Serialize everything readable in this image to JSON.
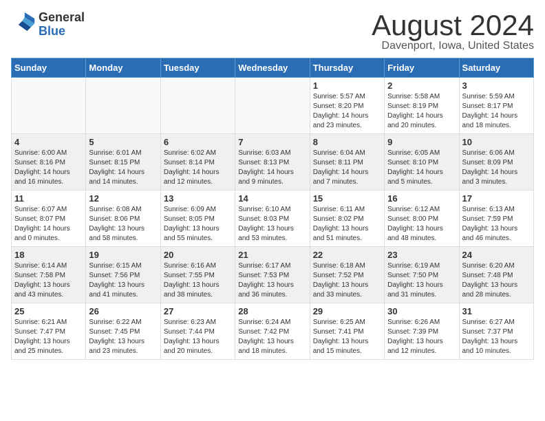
{
  "logo": {
    "general": "General",
    "blue": "Blue"
  },
  "title": "August 2024",
  "subtitle": "Davenport, Iowa, United States",
  "header": {
    "days": [
      "Sunday",
      "Monday",
      "Tuesday",
      "Wednesday",
      "Thursday",
      "Friday",
      "Saturday"
    ]
  },
  "weeks": [
    [
      {
        "day": "",
        "info": ""
      },
      {
        "day": "",
        "info": ""
      },
      {
        "day": "",
        "info": ""
      },
      {
        "day": "",
        "info": ""
      },
      {
        "day": "1",
        "info": "Sunrise: 5:57 AM\nSunset: 8:20 PM\nDaylight: 14 hours\nand 23 minutes."
      },
      {
        "day": "2",
        "info": "Sunrise: 5:58 AM\nSunset: 8:19 PM\nDaylight: 14 hours\nand 20 minutes."
      },
      {
        "day": "3",
        "info": "Sunrise: 5:59 AM\nSunset: 8:17 PM\nDaylight: 14 hours\nand 18 minutes."
      }
    ],
    [
      {
        "day": "4",
        "info": "Sunrise: 6:00 AM\nSunset: 8:16 PM\nDaylight: 14 hours\nand 16 minutes."
      },
      {
        "day": "5",
        "info": "Sunrise: 6:01 AM\nSunset: 8:15 PM\nDaylight: 14 hours\nand 14 minutes."
      },
      {
        "day": "6",
        "info": "Sunrise: 6:02 AM\nSunset: 8:14 PM\nDaylight: 14 hours\nand 12 minutes."
      },
      {
        "day": "7",
        "info": "Sunrise: 6:03 AM\nSunset: 8:13 PM\nDaylight: 14 hours\nand 9 minutes."
      },
      {
        "day": "8",
        "info": "Sunrise: 6:04 AM\nSunset: 8:11 PM\nDaylight: 14 hours\nand 7 minutes."
      },
      {
        "day": "9",
        "info": "Sunrise: 6:05 AM\nSunset: 8:10 PM\nDaylight: 14 hours\nand 5 minutes."
      },
      {
        "day": "10",
        "info": "Sunrise: 6:06 AM\nSunset: 8:09 PM\nDaylight: 14 hours\nand 3 minutes."
      }
    ],
    [
      {
        "day": "11",
        "info": "Sunrise: 6:07 AM\nSunset: 8:07 PM\nDaylight: 14 hours\nand 0 minutes."
      },
      {
        "day": "12",
        "info": "Sunrise: 6:08 AM\nSunset: 8:06 PM\nDaylight: 13 hours\nand 58 minutes."
      },
      {
        "day": "13",
        "info": "Sunrise: 6:09 AM\nSunset: 8:05 PM\nDaylight: 13 hours\nand 55 minutes."
      },
      {
        "day": "14",
        "info": "Sunrise: 6:10 AM\nSunset: 8:03 PM\nDaylight: 13 hours\nand 53 minutes."
      },
      {
        "day": "15",
        "info": "Sunrise: 6:11 AM\nSunset: 8:02 PM\nDaylight: 13 hours\nand 51 minutes."
      },
      {
        "day": "16",
        "info": "Sunrise: 6:12 AM\nSunset: 8:00 PM\nDaylight: 13 hours\nand 48 minutes."
      },
      {
        "day": "17",
        "info": "Sunrise: 6:13 AM\nSunset: 7:59 PM\nDaylight: 13 hours\nand 46 minutes."
      }
    ],
    [
      {
        "day": "18",
        "info": "Sunrise: 6:14 AM\nSunset: 7:58 PM\nDaylight: 13 hours\nand 43 minutes."
      },
      {
        "day": "19",
        "info": "Sunrise: 6:15 AM\nSunset: 7:56 PM\nDaylight: 13 hours\nand 41 minutes."
      },
      {
        "day": "20",
        "info": "Sunrise: 6:16 AM\nSunset: 7:55 PM\nDaylight: 13 hours\nand 38 minutes."
      },
      {
        "day": "21",
        "info": "Sunrise: 6:17 AM\nSunset: 7:53 PM\nDaylight: 13 hours\nand 36 minutes."
      },
      {
        "day": "22",
        "info": "Sunrise: 6:18 AM\nSunset: 7:52 PM\nDaylight: 13 hours\nand 33 minutes."
      },
      {
        "day": "23",
        "info": "Sunrise: 6:19 AM\nSunset: 7:50 PM\nDaylight: 13 hours\nand 31 minutes."
      },
      {
        "day": "24",
        "info": "Sunrise: 6:20 AM\nSunset: 7:48 PM\nDaylight: 13 hours\nand 28 minutes."
      }
    ],
    [
      {
        "day": "25",
        "info": "Sunrise: 6:21 AM\nSunset: 7:47 PM\nDaylight: 13 hours\nand 25 minutes."
      },
      {
        "day": "26",
        "info": "Sunrise: 6:22 AM\nSunset: 7:45 PM\nDaylight: 13 hours\nand 23 minutes."
      },
      {
        "day": "27",
        "info": "Sunrise: 6:23 AM\nSunset: 7:44 PM\nDaylight: 13 hours\nand 20 minutes."
      },
      {
        "day": "28",
        "info": "Sunrise: 6:24 AM\nSunset: 7:42 PM\nDaylight: 13 hours\nand 18 minutes."
      },
      {
        "day": "29",
        "info": "Sunrise: 6:25 AM\nSunset: 7:41 PM\nDaylight: 13 hours\nand 15 minutes."
      },
      {
        "day": "30",
        "info": "Sunrise: 6:26 AM\nSunset: 7:39 PM\nDaylight: 13 hours\nand 12 minutes."
      },
      {
        "day": "31",
        "info": "Sunrise: 6:27 AM\nSunset: 7:37 PM\nDaylight: 13 hours\nand 10 minutes."
      }
    ]
  ]
}
